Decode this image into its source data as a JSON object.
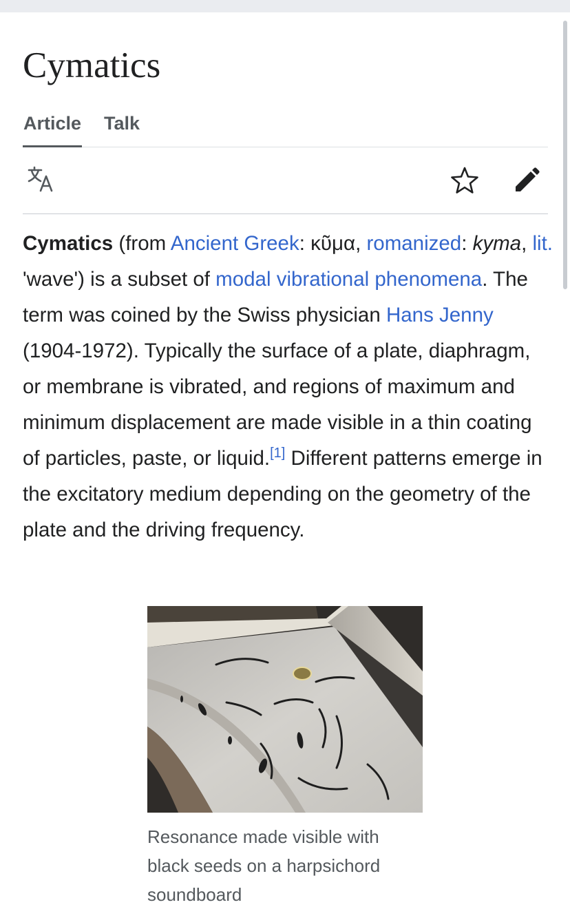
{
  "page": {
    "title": "Cymatics"
  },
  "tabs": [
    {
      "label": "Article",
      "active": true
    },
    {
      "label": "Talk",
      "active": false
    }
  ],
  "toolbar": {
    "language_icon": "translate-icon",
    "watch_icon": "star-icon",
    "edit_icon": "pencil-icon"
  },
  "intro": {
    "s1": "Cymatics",
    "s2": " (from ",
    "link_ancient_greek": "Ancient Greek",
    "s3": ": ",
    "greek": "κῦμα",
    "s4": ", ",
    "link_romanized": "romanized",
    "s5": ": ",
    "kyma": "kyma",
    "s6": ", ",
    "link_lit": "lit.",
    "s7": " 'wave') is a subset of ",
    "link_modal": "modal vibrational phenomena",
    "s8": ". The term was coined by the Swiss physician ",
    "link_hans": "Hans Jenny",
    "s9": " (1904-1972). Typically the surface of a plate, diaphragm, or membrane is vibrated, and regions of maximum and minimum displacement are made visible in a thin coating of particles, paste, or liquid.",
    "ref": "[1]",
    "s10": " Different patterns emerge in the excitatory medium depending on the geometry of the plate and the driving frequency."
  },
  "figure": {
    "caption": "Resonance made visible with black seeds on a harpsichord soundboard"
  },
  "colors": {
    "link": "#3366cc",
    "text": "#202122",
    "muted": "#54595d"
  }
}
